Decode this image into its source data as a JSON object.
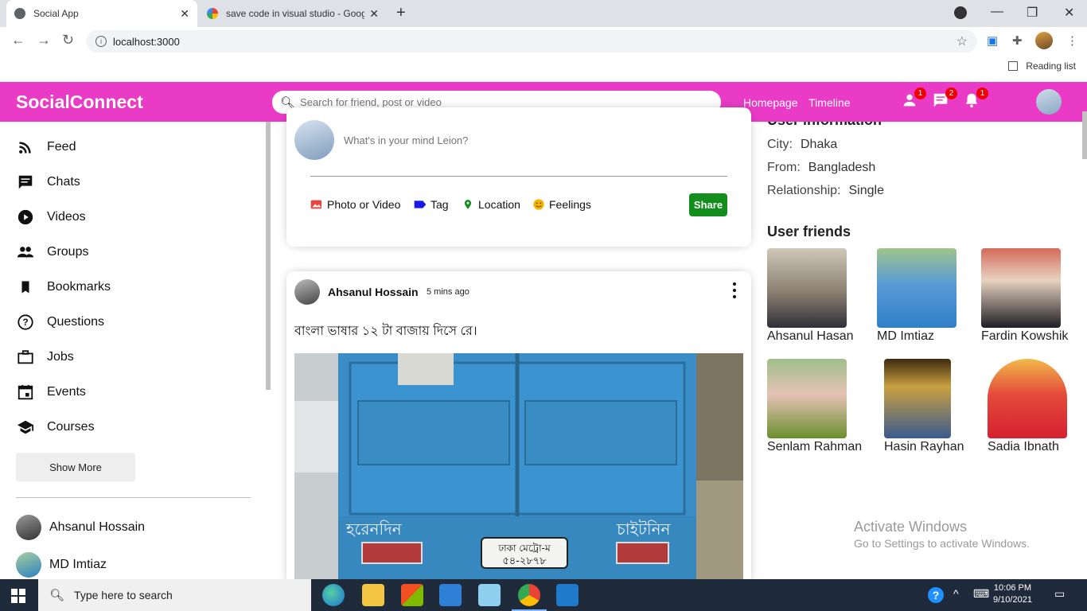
{
  "browser": {
    "tabs": [
      {
        "title": "Social App",
        "active": true
      },
      {
        "title": "save code in visual studio - Goog",
        "active": false
      }
    ],
    "url": "localhost:3000",
    "reading_list": "Reading list"
  },
  "topbar": {
    "logo": "SocialConnect",
    "search_placeholder": "Search for friend, post or video",
    "links": [
      "Homepage",
      "Timeline"
    ],
    "badges": {
      "friends": "1",
      "chats": "2",
      "notifications": "1"
    },
    "accent_color": "#ea3bc7"
  },
  "sidebar": {
    "items": [
      {
        "label": "Feed",
        "icon": "rss-icon"
      },
      {
        "label": "Chats",
        "icon": "chat-icon"
      },
      {
        "label": "Videos",
        "icon": "play-circle-icon"
      },
      {
        "label": "Groups",
        "icon": "group-icon"
      },
      {
        "label": "Bookmarks",
        "icon": "bookmark-icon"
      },
      {
        "label": "Questions",
        "icon": "help-circle-icon"
      },
      {
        "label": "Jobs",
        "icon": "briefcase-icon"
      },
      {
        "label": "Events",
        "icon": "calendar-icon"
      },
      {
        "label": "Courses",
        "icon": "school-icon"
      }
    ],
    "show_more": "Show More",
    "friends": [
      "Ahsanul Hossain",
      "MD Imtiaz"
    ]
  },
  "share": {
    "placeholder": "What's in your mind Leion?",
    "options": [
      "Photo or Video",
      "Tag",
      "Location",
      "Feelings"
    ],
    "share_button": "Share",
    "share_color": "#138d1b"
  },
  "post": {
    "username": "Ahsanul Hossain",
    "time": "5 mins ago",
    "text": "বাংলা ভাষার ১২ টা বাজায় দিসে রে।",
    "image_text": {
      "left": "হরেনদিন",
      "right": "চাইটনিন",
      "plate_line1": "ঢাকা মেট্রো-ম",
      "plate_line2": "৫৪-২৮৭৮"
    }
  },
  "rightbar": {
    "title": "User information",
    "info": [
      {
        "key": "City:",
        "value": "Dhaka"
      },
      {
        "key": "From:",
        "value": "Bangladesh"
      },
      {
        "key": "Relationship:",
        "value": "Single"
      }
    ],
    "friends_title": "User friends",
    "friends": [
      "Ahsanul Hasan",
      "MD Imtiaz",
      "Fardin Kowshik",
      "Senlam Rahman",
      "Hasin Rayhan",
      "Sadia Ibnath"
    ]
  },
  "watermark": {
    "line1": "Activate Windows",
    "line2": "Go to Settings to activate Windows."
  },
  "taskbar": {
    "search_placeholder": "Type here to search",
    "time": "10:06 PM",
    "date": "9/10/2021"
  }
}
